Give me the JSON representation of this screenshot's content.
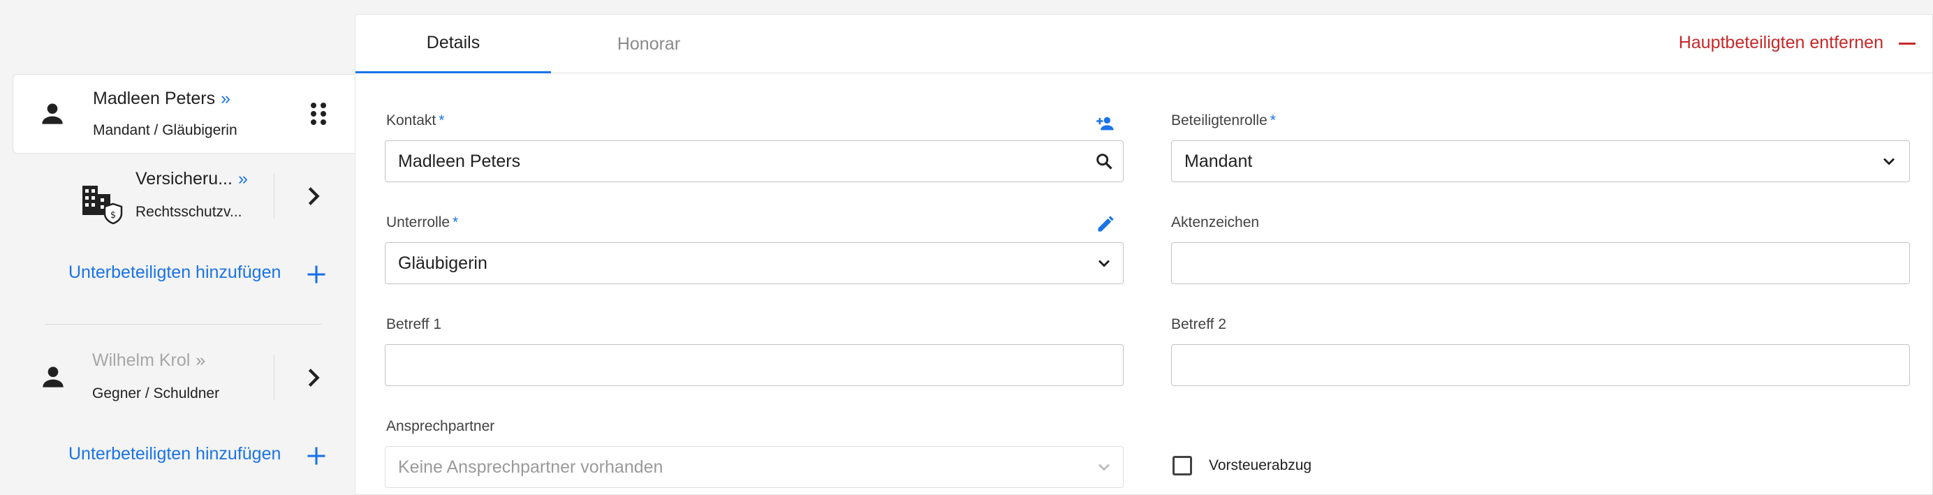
{
  "sidebar": {
    "main_party": {
      "name": "Madleen Peters",
      "arrow": "»",
      "role": "Mandant / Gläubigerin"
    },
    "sub_party": {
      "name": "Versicheru...",
      "arrow": "»",
      "role": "Rechtsschutzv..."
    },
    "add_sub_1": "Unterbeteiligten hinzufügen",
    "second_party": {
      "name": "Wilhelm Krol",
      "arrow": "»",
      "role": "Gegner / Schuldner"
    },
    "add_sub_2": "Unterbeteiligten hinzufügen"
  },
  "tabs": {
    "details": "Details",
    "fee": "Honorar"
  },
  "remove_main": "Hauptbeteiligten entfernen",
  "form": {
    "contact": {
      "label": "Kontakt",
      "required": "*",
      "value": "Madleen Peters"
    },
    "role": {
      "label": "Beteiligtenrolle",
      "required": "*",
      "value": "Mandant"
    },
    "subrole": {
      "label": "Unterrolle",
      "required": "*",
      "value": "Gläubigerin"
    },
    "file_number": {
      "label": "Aktenzeichen",
      "value": ""
    },
    "subject1": {
      "label": "Betreff 1",
      "value": ""
    },
    "subject2": {
      "label": "Betreff 2",
      "value": ""
    },
    "contact_person": {
      "label": "Ansprechpartner",
      "value": "Keine Ansprechpartner vorhanden"
    },
    "vat_deduction": {
      "label": "Vorsteuerabzug",
      "checked": false
    }
  },
  "colors": {
    "accent": "#1a73e8",
    "danger": "#c62828",
    "text": "#212121",
    "muted": "#9e9e9e"
  },
  "icons": [
    "person-icon",
    "building-shield-icon",
    "drag-handle-icon",
    "chevron-right-icon",
    "plus-icon",
    "minus-icon",
    "search-icon",
    "person-add-icon",
    "pencil-icon",
    "chevron-down-icon"
  ]
}
